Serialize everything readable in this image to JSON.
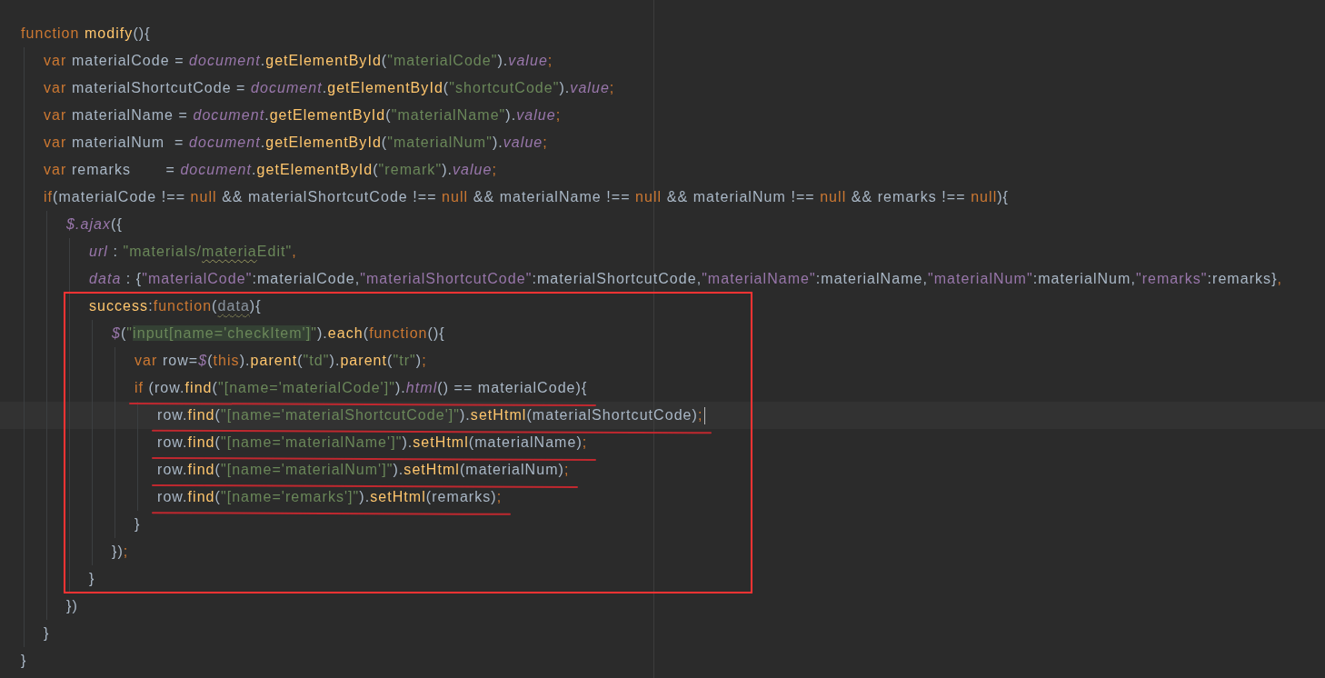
{
  "lines": [
    {
      "tokens": [
        {
          "kind": "kw",
          "text": "function"
        },
        {
          "kind": "fn",
          "text": " modify"
        },
        {
          "kind": "id",
          "text": "(){"
        }
      ],
      "children": [
        {
          "tokens": [
            {
              "kind": "kw",
              "text": "var"
            },
            {
              "kind": "id",
              "text": " materialCode = "
            },
            {
              "kind": "obj",
              "text": "document"
            },
            {
              "kind": "id",
              "text": "."
            },
            {
              "kind": "fn",
              "text": "getElementById"
            },
            {
              "kind": "id",
              "text": "("
            },
            {
              "kind": "str",
              "text": "\"materialCode\""
            },
            {
              "kind": "id",
              "text": ")."
            },
            {
              "kind": "obj",
              "text": "value"
            },
            {
              "kind": "kw",
              "text": ";"
            }
          ]
        },
        {
          "tokens": [
            {
              "kind": "kw",
              "text": "var"
            },
            {
              "kind": "id",
              "text": " materialShortcutCode = "
            },
            {
              "kind": "obj",
              "text": "document"
            },
            {
              "kind": "id",
              "text": "."
            },
            {
              "kind": "fn",
              "text": "getElementById"
            },
            {
              "kind": "id",
              "text": "("
            },
            {
              "kind": "str",
              "text": "\"shortcutCode\""
            },
            {
              "kind": "id",
              "text": ")."
            },
            {
              "kind": "obj",
              "text": "value"
            },
            {
              "kind": "kw",
              "text": ";"
            }
          ]
        },
        {
          "tokens": [
            {
              "kind": "kw",
              "text": "var"
            },
            {
              "kind": "id",
              "text": " materialName = "
            },
            {
              "kind": "obj",
              "text": "document"
            },
            {
              "kind": "id",
              "text": "."
            },
            {
              "kind": "fn",
              "text": "getElementById"
            },
            {
              "kind": "id",
              "text": "("
            },
            {
              "kind": "str",
              "text": "\"materialName\""
            },
            {
              "kind": "id",
              "text": ")."
            },
            {
              "kind": "obj",
              "text": "value"
            },
            {
              "kind": "kw",
              "text": ";"
            }
          ]
        },
        {
          "tokens": [
            {
              "kind": "kw",
              "text": "var"
            },
            {
              "kind": "id",
              "text": " materialNum  = "
            },
            {
              "kind": "obj",
              "text": "document"
            },
            {
              "kind": "id",
              "text": "."
            },
            {
              "kind": "fn",
              "text": "getElementById"
            },
            {
              "kind": "id",
              "text": "("
            },
            {
              "kind": "str",
              "text": "\"materialNum\""
            },
            {
              "kind": "id",
              "text": ")."
            },
            {
              "kind": "obj",
              "text": "value"
            },
            {
              "kind": "kw",
              "text": ";"
            }
          ]
        },
        {
          "tokens": [
            {
              "kind": "kw",
              "text": "var"
            },
            {
              "kind": "id",
              "text": " remarks       = "
            },
            {
              "kind": "obj",
              "text": "document"
            },
            {
              "kind": "id",
              "text": "."
            },
            {
              "kind": "fn",
              "text": "getElementById"
            },
            {
              "kind": "id",
              "text": "("
            },
            {
              "kind": "str",
              "text": "\"remark\""
            },
            {
              "kind": "id",
              "text": ")."
            },
            {
              "kind": "obj",
              "text": "value"
            },
            {
              "kind": "kw",
              "text": ";"
            }
          ]
        },
        {
          "tokens": [
            {
              "kind": "kw",
              "text": "if"
            },
            {
              "kind": "id",
              "text": "(materialCode !== "
            },
            {
              "kind": "kw",
              "text": "null"
            },
            {
              "kind": "id",
              "text": " && materialShortcutCode !== "
            },
            {
              "kind": "kw",
              "text": "null"
            },
            {
              "kind": "id",
              "text": " && materialName !== "
            },
            {
              "kind": "kw",
              "text": "null"
            },
            {
              "kind": "id",
              "text": " && materialNum !== "
            },
            {
              "kind": "kw",
              "text": "null"
            },
            {
              "kind": "id",
              "text": " && remarks !== "
            },
            {
              "kind": "kw",
              "text": "null"
            },
            {
              "kind": "id",
              "text": "){"
            }
          ],
          "children": [
            {
              "tokens": [
                {
                  "kind": "obj",
                  "text": "$.ajax"
                },
                {
                  "kind": "id",
                  "text": "({"
                }
              ],
              "children": [
                {
                  "tokens": [
                    {
                      "kind": "obj",
                      "text": "url"
                    },
                    {
                      "kind": "id",
                      "text": " : "
                    },
                    {
                      "kind": "str",
                      "text": "\"materials/"
                    },
                    {
                      "kind": "str",
                      "text": "materia",
                      "squiggle": true
                    },
                    {
                      "kind": "str",
                      "text": "Edit\""
                    },
                    {
                      "kind": "kw",
                      "text": ","
                    }
                  ]
                },
                {
                  "tokens": [
                    {
                      "kind": "obj",
                      "text": "data"
                    },
                    {
                      "kind": "id",
                      "text": " : {"
                    },
                    {
                      "kind": "key",
                      "text": "\"materialCode\""
                    },
                    {
                      "kind": "id",
                      "text": ":materialCode,"
                    },
                    {
                      "kind": "key",
                      "text": "\"materialShortcutCode\""
                    },
                    {
                      "kind": "id",
                      "text": ":materialShortcutCode,"
                    },
                    {
                      "kind": "key",
                      "text": "\"materialName\""
                    },
                    {
                      "kind": "id",
                      "text": ":materialName,"
                    },
                    {
                      "kind": "key",
                      "text": "\"materialNum\""
                    },
                    {
                      "kind": "id",
                      "text": ":materialNum,"
                    },
                    {
                      "kind": "key",
                      "text": "\"remarks\""
                    },
                    {
                      "kind": "id",
                      "text": ":remarks}"
                    },
                    {
                      "kind": "kw",
                      "text": ","
                    }
                  ]
                },
                {
                  "boxed": true,
                  "tokens": [
                    {
                      "kind": "fn",
                      "text": "success"
                    },
                    {
                      "kind": "id",
                      "text": ":"
                    },
                    {
                      "kind": "kw",
                      "text": "function"
                    },
                    {
                      "kind": "id",
                      "text": "("
                    },
                    {
                      "kind": "param",
                      "text": "data",
                      "squiggle": true
                    },
                    {
                      "kind": "id",
                      "text": "){"
                    }
                  ],
                  "children": [
                    {
                      "tokens": [
                        {
                          "kind": "obj",
                          "text": "$"
                        },
                        {
                          "kind": "id",
                          "text": "("
                        },
                        {
                          "kind": "str",
                          "text": "\""
                        },
                        {
                          "kind": "str",
                          "text": "input[name='checkItem']",
                          "highlighted": true
                        },
                        {
                          "kind": "str",
                          "text": "\""
                        },
                        {
                          "kind": "id",
                          "text": ")."
                        },
                        {
                          "kind": "fn",
                          "text": "each"
                        },
                        {
                          "kind": "id",
                          "text": "("
                        },
                        {
                          "kind": "kw",
                          "text": "function"
                        },
                        {
                          "kind": "id",
                          "text": "(){"
                        }
                      ],
                      "children": [
                        {
                          "tokens": [
                            {
                              "kind": "kw",
                              "text": "var"
                            },
                            {
                              "kind": "id",
                              "text": " row="
                            },
                            {
                              "kind": "obj",
                              "text": "$"
                            },
                            {
                              "kind": "id",
                              "text": "("
                            },
                            {
                              "kind": "kw",
                              "text": "this"
                            },
                            {
                              "kind": "id",
                              "text": ")."
                            },
                            {
                              "kind": "fn",
                              "text": "parent"
                            },
                            {
                              "kind": "id",
                              "text": "("
                            },
                            {
                              "kind": "str",
                              "text": "\"td\""
                            },
                            {
                              "kind": "id",
                              "text": ")."
                            },
                            {
                              "kind": "fn",
                              "text": "parent"
                            },
                            {
                              "kind": "id",
                              "text": "("
                            },
                            {
                              "kind": "str",
                              "text": "\"tr\""
                            },
                            {
                              "kind": "id",
                              "text": ")"
                            },
                            {
                              "kind": "kw",
                              "text": ";"
                            }
                          ]
                        },
                        {
                          "underlined": true,
                          "tokens": [
                            {
                              "kind": "kw",
                              "text": "if"
                            },
                            {
                              "kind": "id",
                              "text": " (row."
                            },
                            {
                              "kind": "fn",
                              "text": "find"
                            },
                            {
                              "kind": "id",
                              "text": "("
                            },
                            {
                              "kind": "str",
                              "text": "\"[name='materialCode']\""
                            },
                            {
                              "kind": "id",
                              "text": ")."
                            },
                            {
                              "kind": "obj",
                              "text": "html"
                            },
                            {
                              "kind": "id",
                              "text": "() == materialCode){"
                            }
                          ],
                          "children": [
                            {
                              "underlined": true,
                              "current": true,
                              "tokens": [
                                {
                                  "kind": "id",
                                  "text": "row."
                                },
                                {
                                  "kind": "fn",
                                  "text": "find"
                                },
                                {
                                  "kind": "id",
                                  "text": "("
                                },
                                {
                                  "kind": "str",
                                  "text": "\"[name='materialShortcutCode']\""
                                },
                                {
                                  "kind": "id",
                                  "text": ")."
                                },
                                {
                                  "kind": "fn",
                                  "text": "setHtml"
                                },
                                {
                                  "kind": "id",
                                  "text": "(materialShortcutCode)"
                                },
                                {
                                  "kind": "kw",
                                  "text": ";"
                                }
                              ]
                            },
                            {
                              "underlined": true,
                              "tokens": [
                                {
                                  "kind": "id",
                                  "text": "row."
                                },
                                {
                                  "kind": "fn",
                                  "text": "find"
                                },
                                {
                                  "kind": "id",
                                  "text": "("
                                },
                                {
                                  "kind": "str",
                                  "text": "\"[name='materialName']\""
                                },
                                {
                                  "kind": "id",
                                  "text": ")."
                                },
                                {
                                  "kind": "fn",
                                  "text": "setHtml"
                                },
                                {
                                  "kind": "id",
                                  "text": "(materialName)"
                                },
                                {
                                  "kind": "kw",
                                  "text": ";"
                                }
                              ]
                            },
                            {
                              "underlined": true,
                              "tokens": [
                                {
                                  "kind": "id",
                                  "text": "row."
                                },
                                {
                                  "kind": "fn",
                                  "text": "find"
                                },
                                {
                                  "kind": "id",
                                  "text": "("
                                },
                                {
                                  "kind": "str",
                                  "text": "\"[name='materialNum']\""
                                },
                                {
                                  "kind": "id",
                                  "text": ")."
                                },
                                {
                                  "kind": "fn",
                                  "text": "setHtml"
                                },
                                {
                                  "kind": "id",
                                  "text": "(materialNum)"
                                },
                                {
                                  "kind": "kw",
                                  "text": ";"
                                }
                              ]
                            },
                            {
                              "underlined": true,
                              "tokens": [
                                {
                                  "kind": "id",
                                  "text": "row."
                                },
                                {
                                  "kind": "fn",
                                  "text": "find"
                                },
                                {
                                  "kind": "id",
                                  "text": "("
                                },
                                {
                                  "kind": "str",
                                  "text": "\"[name='remarks']\""
                                },
                                {
                                  "kind": "id",
                                  "text": ")."
                                },
                                {
                                  "kind": "fn",
                                  "text": "setHtml"
                                },
                                {
                                  "kind": "id",
                                  "text": "(remarks)"
                                },
                                {
                                  "kind": "kw",
                                  "text": ";"
                                }
                              ]
                            }
                          ],
                          "closing": [
                            {
                              "kind": "id",
                              "text": "}"
                            }
                          ]
                        }
                      ],
                      "closing": [
                        {
                          "kind": "id",
                          "text": "})"
                        },
                        {
                          "kind": "kw",
                          "text": ";"
                        }
                      ]
                    }
                  ],
                  "closing": [
                    {
                      "kind": "id",
                      "text": "}"
                    }
                  ]
                }
              ],
              "closing": [
                {
                  "kind": "id",
                  "text": "})"
                }
              ]
            }
          ],
          "closing": [
            {
              "kind": "id",
              "text": "}"
            }
          ]
        }
      ],
      "closing": [
        {
          "kind": "id",
          "text": "}"
        }
      ]
    }
  ]
}
